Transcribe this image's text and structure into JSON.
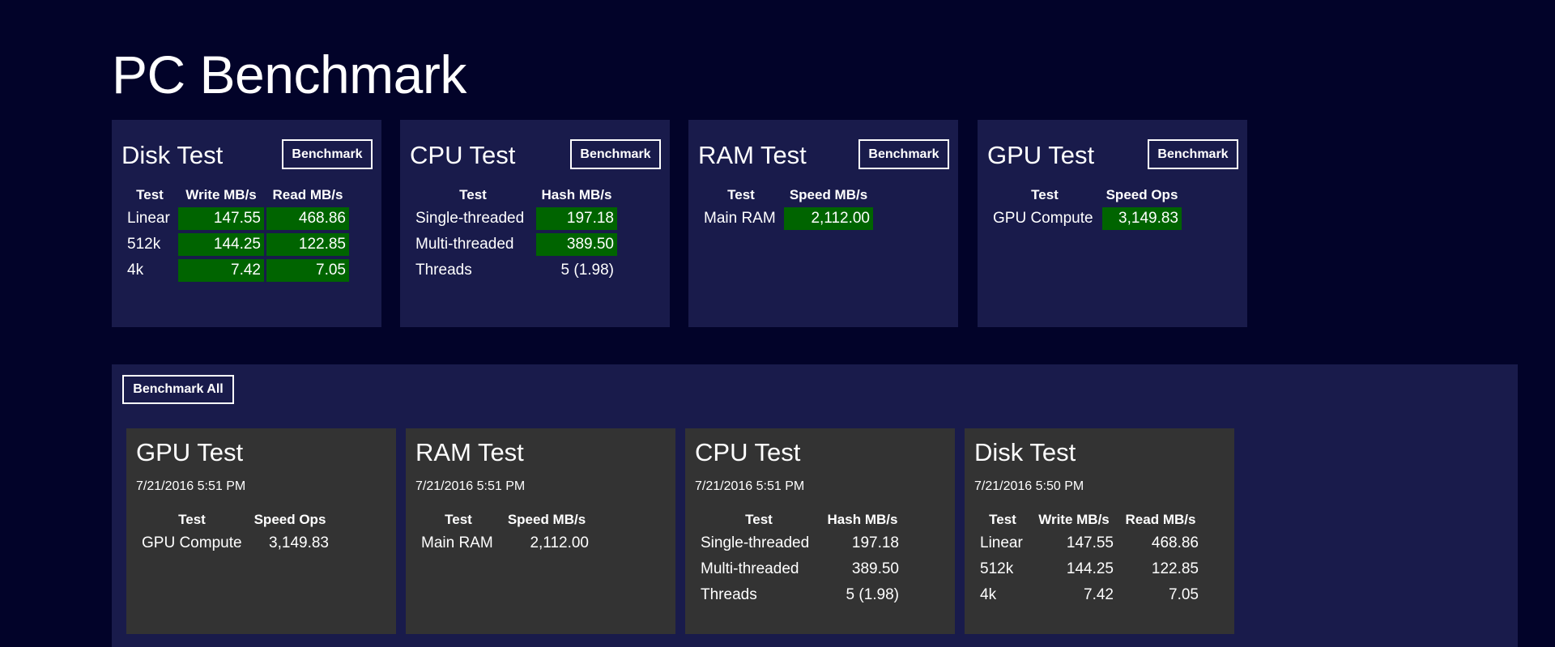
{
  "app": {
    "title": "PC Benchmark"
  },
  "tiles": {
    "disk": {
      "title": "Disk Test",
      "button": "Benchmark",
      "headers": [
        "Test",
        "Write MB/s",
        "Read MB/s"
      ],
      "rows": [
        [
          "Linear",
          "147.55",
          "468.86"
        ],
        [
          "512k",
          "144.25",
          "122.85"
        ],
        [
          "4k",
          "7.42",
          "7.05"
        ]
      ]
    },
    "cpu": {
      "title": "CPU Test",
      "button": "Benchmark",
      "headers": [
        "Test",
        "Hash MB/s"
      ],
      "rows": [
        [
          "Single-threaded",
          "197.18"
        ],
        [
          "Multi-threaded",
          "389.50"
        ],
        [
          "Threads",
          "5 (1.98)"
        ]
      ]
    },
    "ram": {
      "title": "RAM Test",
      "button": "Benchmark",
      "headers": [
        "Test",
        "Speed MB/s"
      ],
      "rows": [
        [
          "Main RAM",
          "2,112.00"
        ]
      ]
    },
    "gpu": {
      "title": "GPU Test",
      "button": "Benchmark",
      "headers": [
        "Test",
        "Speed Ops"
      ],
      "rows": [
        [
          "GPU Compute",
          "3,149.83"
        ]
      ]
    }
  },
  "history": {
    "button": "Benchmark All",
    "gpu": {
      "title": "GPU Test",
      "date": "7/21/2016 5:51 PM",
      "headers": [
        "Test",
        "Speed Ops"
      ],
      "rows": [
        [
          "GPU Compute",
          "3,149.83"
        ]
      ]
    },
    "ram": {
      "title": "RAM Test",
      "date": "7/21/2016 5:51 PM",
      "headers": [
        "Test",
        "Speed MB/s"
      ],
      "rows": [
        [
          "Main RAM",
          "2,112.00"
        ]
      ]
    },
    "cpu": {
      "title": "CPU Test",
      "date": "7/21/2016 5:51 PM",
      "headers": [
        "Test",
        "Hash MB/s"
      ],
      "rows": [
        [
          "Single-threaded",
          "197.18"
        ],
        [
          "Multi-threaded",
          "389.50"
        ],
        [
          "Threads",
          "5 (1.98)"
        ]
      ]
    },
    "disk": {
      "title": "Disk Test",
      "date": "7/21/2016 5:50 PM",
      "headers": [
        "Test",
        "Write MB/s",
        "Read MB/s"
      ],
      "rows": [
        [
          "Linear",
          "147.55",
          "468.86"
        ],
        [
          "512k",
          "144.25",
          "122.85"
        ],
        [
          "4k",
          "7.42",
          "7.05"
        ]
      ]
    }
  },
  "colors": {
    "background": "#020329",
    "tile": "#191b4b",
    "history_tile": "#333333",
    "highlight": "#006400"
  }
}
